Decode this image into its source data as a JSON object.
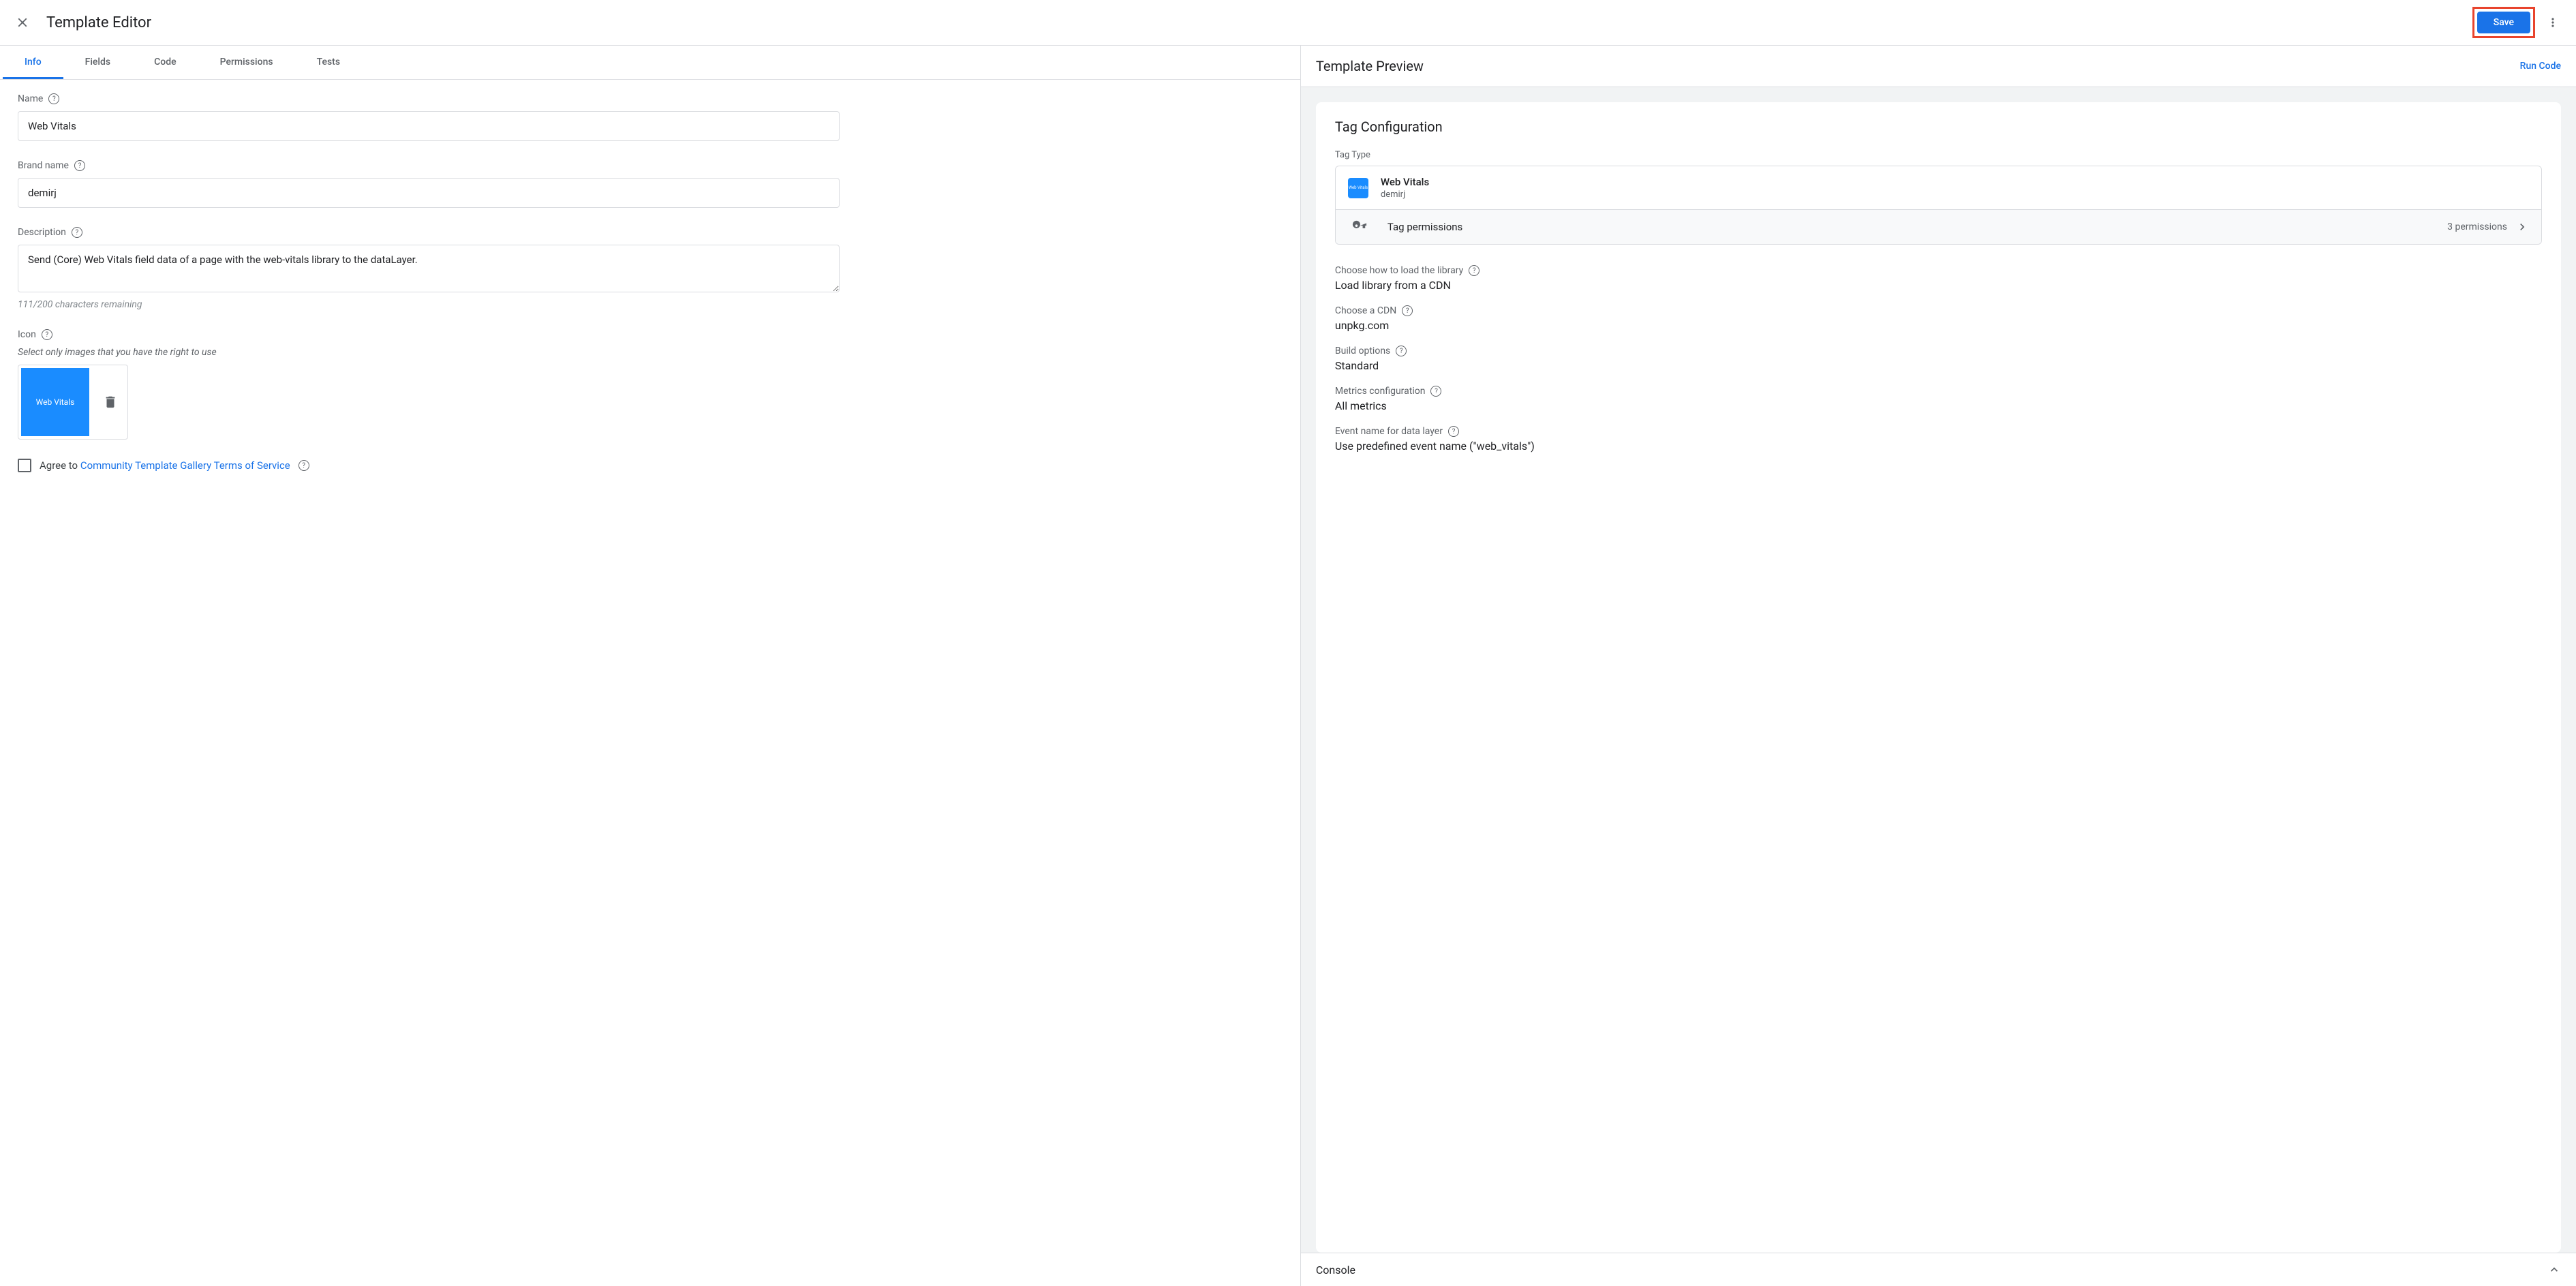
{
  "header": {
    "title": "Template Editor",
    "save_label": "Save"
  },
  "tabs": [
    "Info",
    "Fields",
    "Code",
    "Permissions",
    "Tests"
  ],
  "active_tab_index": 0,
  "form": {
    "name_label": "Name",
    "name_value": "Web Vitals",
    "brand_label": "Brand name",
    "brand_value": "demirj",
    "desc_label": "Description",
    "desc_value": "Send (Core) Web Vitals field data of a page with the web-vitals library to the dataLayer.",
    "desc_counter": "111/200 characters remaining",
    "icon_label": "Icon",
    "icon_hint": "Select only images that you have the right to use",
    "icon_thumb_text": "Web Vitals",
    "agree_prefix": "Agree to ",
    "agree_link": "Community Template Gallery Terms of Service"
  },
  "preview": {
    "header": "Template Preview",
    "run_code": "Run Code",
    "card_title": "Tag Configuration",
    "tag_type_label": "Tag Type",
    "tag_name": "Web Vitals",
    "tag_brand": "demirj",
    "tag_logo_text": "Web Vitals",
    "permissions_label": "Tag permissions",
    "permissions_count": "3 permissions",
    "config": [
      {
        "label": "Choose how to load the library",
        "value": "Load library from a CDN",
        "help": true
      },
      {
        "label": "Choose a CDN",
        "value": "unpkg.com",
        "help": true
      },
      {
        "label": "Build options",
        "value": "Standard",
        "help": true
      },
      {
        "label": "Metrics configuration",
        "value": "All metrics",
        "help": true
      },
      {
        "label": "Event name for data layer",
        "value": "Use predefined event name (\"web_vitals\")",
        "help": true
      }
    ]
  },
  "console": {
    "title": "Console"
  }
}
